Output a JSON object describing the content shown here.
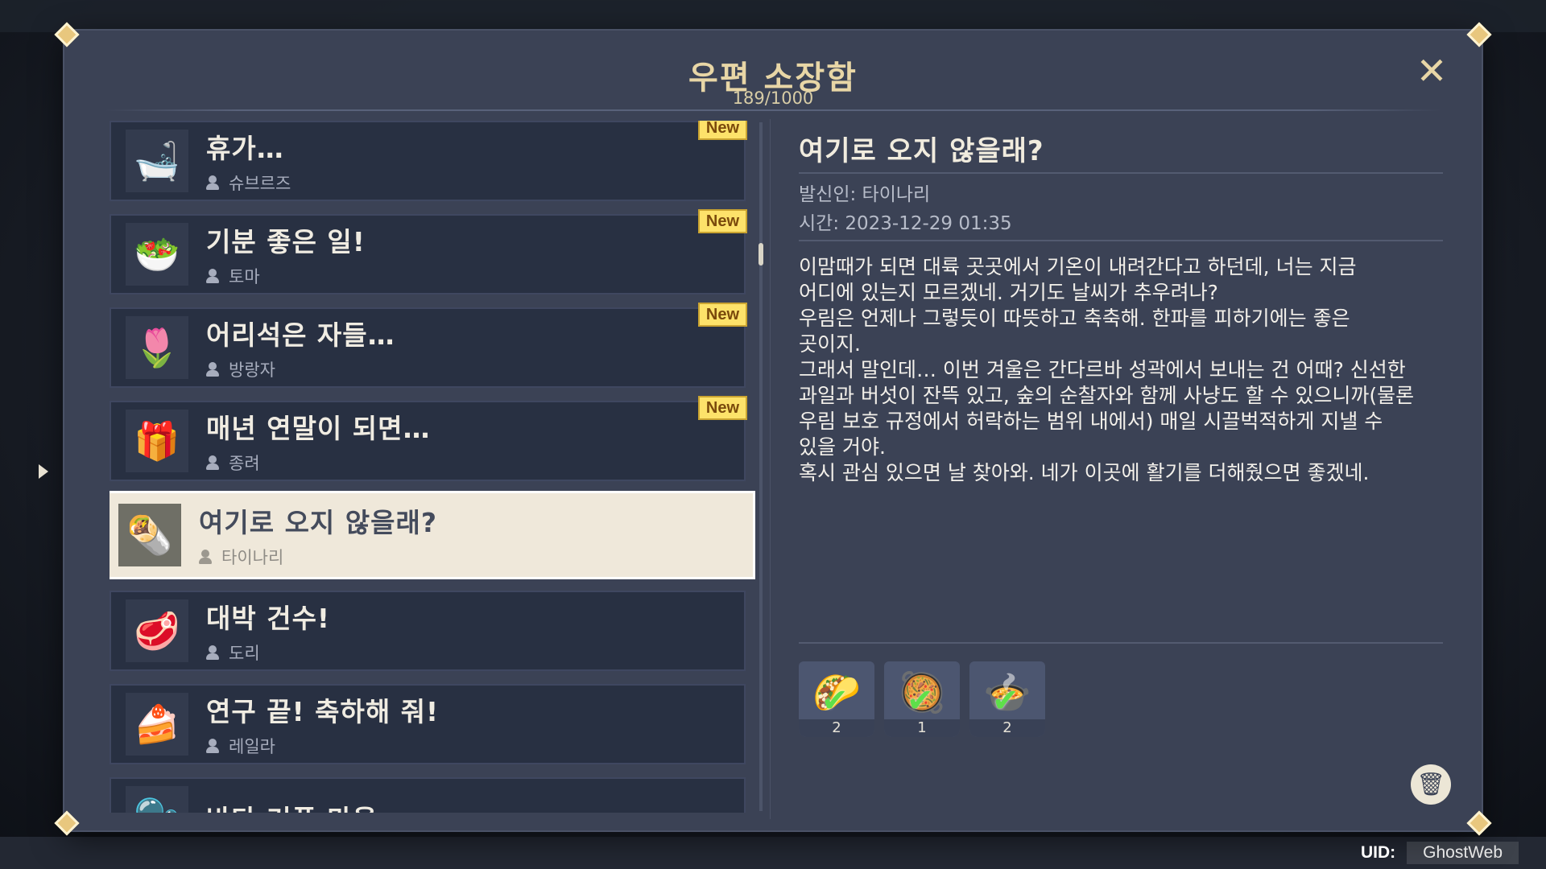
{
  "mailbox": {
    "title": "우편 소장함",
    "count": "189/1000"
  },
  "list": {
    "items": [
      {
        "subject": "휴가…",
        "sender": "슈브르즈",
        "badge": "New",
        "icon": "bathtub-icon",
        "glyph": "🛁"
      },
      {
        "subject": "기분 좋은 일!",
        "sender": "토마",
        "badge": "New",
        "icon": "salad-dish-icon",
        "glyph": "🥗"
      },
      {
        "subject": "어리석은 자들…",
        "sender": "방랑자",
        "badge": "New",
        "icon": "flower-icon",
        "glyph": "🌷"
      },
      {
        "subject": "매년 연말이 되면…",
        "sender": "종려",
        "badge": "New",
        "icon": "gift-box-icon",
        "glyph": "🎁"
      },
      {
        "subject": "여기로 오지 않을래?",
        "sender": "타이나리",
        "badge": "",
        "icon": "wrap-dish-icon",
        "glyph": "🌯"
      },
      {
        "subject": "대박 건수!",
        "sender": "도리",
        "badge": "",
        "icon": "raw-meat-icon",
        "glyph": "🥩"
      },
      {
        "subject": "연구 끝! 축하해 줘!",
        "sender": "레일라",
        "badge": "",
        "icon": "baklava-dish-icon",
        "glyph": "🍰"
      },
      {
        "subject": "바다 거품 마을…",
        "sender": "",
        "badge": "",
        "icon": "sea-bubble-icon",
        "glyph": "🫧"
      }
    ],
    "selected_index": 4
  },
  "detail": {
    "subject": "여기로 오지 않을래?",
    "sender": "발신인: 타이나리",
    "time": "시간: 2023-12-29 01:35",
    "body": [
      "이맘때가 되면 대륙 곳곳에서 기온이 내려간다고 하던데, 너는 지금",
      "어디에 있는지 모르겠네. 거기도 날씨가 추우려나?",
      "우림은 언제나 그렇듯이 따뜻하고 축축해. 한파를 피하기에는 좋은",
      "곳이지.",
      "그래서 말인데… 이번 겨울은 간다르바 성곽에서 보내는 건 어때? 신선한",
      "과일과 버섯이 잔뜩 있고, 숲의 순찰자와 함께 사냥도 할 수 있으니까(물론",
      "우림 보호 규정에서 허락하는 범위 내에서) 매일 시끌벅적하게 지낼 수",
      "있을 거야.",
      "혹시 관심 있으면 날 찾아와. 네가 이곳에 활기를 더해줬으면 좋겠네."
    ],
    "rewards": [
      {
        "icon": "wrap-dish-icon",
        "glyph": "🌮",
        "qty": "2",
        "claimed": true
      },
      {
        "icon": "mushroom-dish-icon",
        "glyph": "🥘",
        "qty": "1",
        "claimed": true
      },
      {
        "icon": "soup-dish-icon",
        "glyph": "🍲",
        "qty": "2",
        "claimed": true
      }
    ]
  },
  "footer": {
    "uid_label": "UID:",
    "uid_value": "GhostWeb"
  },
  "colors": {
    "panel": "#3b4255",
    "item_bg": "#283042",
    "selected_bg": "#efe8da",
    "title_gold": "#e8d6a6",
    "badge_yellow": "#fde26a",
    "claimed_check": "#5ee04a"
  }
}
